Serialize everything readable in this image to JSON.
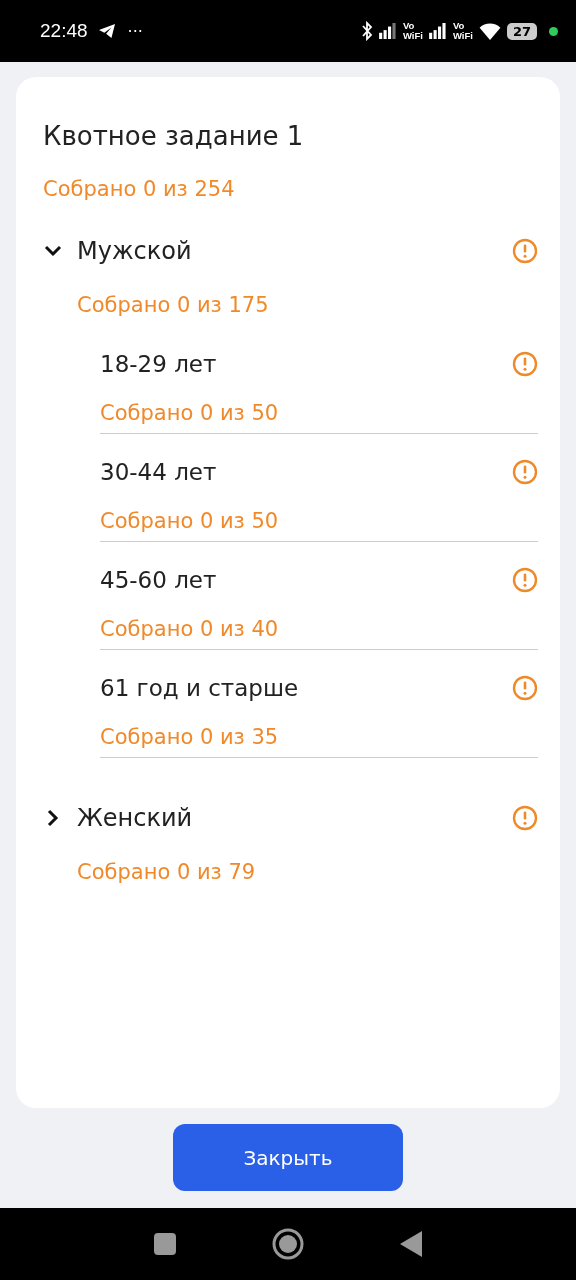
{
  "status_bar": {
    "time": "22:48",
    "more": "···",
    "sim_labels": [
      "Vo\nWiFi",
      "Vo\nWiFi"
    ],
    "battery": "27"
  },
  "quota": {
    "title": "Квотное задание 1",
    "progress": "Собрано 0 из 254",
    "groups": [
      {
        "label": "Мужской",
        "progress": "Собрано 0 из 175",
        "expanded": true,
        "children": [
          {
            "label": "18-29 лет",
            "progress": "Собрано 0 из 50"
          },
          {
            "label": "30-44 лет",
            "progress": "Собрано 0 из 50"
          },
          {
            "label": "45-60 лет",
            "progress": "Собрано 0 из 40"
          },
          {
            "label": "61 год и старше",
            "progress": "Собрано 0 из 35"
          }
        ]
      },
      {
        "label": "Женский",
        "progress": "Собрано 0 из 79",
        "expanded": false
      }
    ]
  },
  "close_button": "Закрыть"
}
